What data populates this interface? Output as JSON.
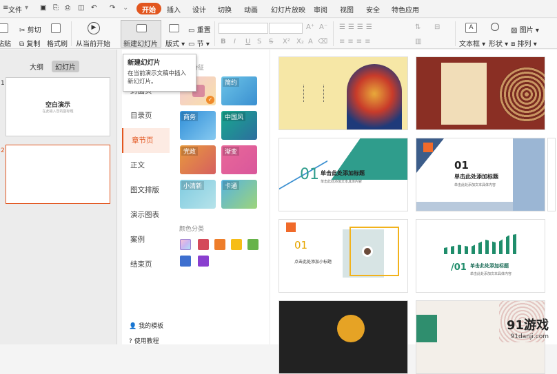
{
  "menubar": {
    "file": "文件",
    "tabs": [
      "开始",
      "插入",
      "设计",
      "切换",
      "动画",
      "幻灯片放映",
      "审阅",
      "视图",
      "安全",
      "特色应用"
    ]
  },
  "ribbon": {
    "cut": "剪切",
    "paste": "粘贴",
    "copy": "复制",
    "format_painter": "格式刷",
    "play_from_current": "从当前开始",
    "new_slide": "新建幻灯片",
    "layout": "版式",
    "reset": "重置",
    "section": "节",
    "textbox": "文本框",
    "shape": "形状",
    "picture": "图片",
    "arrange": "排列"
  },
  "tooltip": {
    "title": "新建幻灯片",
    "desc": "在当前演示文稿中插入新幻灯片。"
  },
  "leftpane": {
    "tab_outline": "大纲",
    "tab_slides": "幻灯片",
    "slide1_num": "1",
    "slide1_title": "空白演示",
    "slide1_subtitle": "在此输入您的副标题",
    "slide2_num": "2"
  },
  "categories": [
    "封面页",
    "目录页",
    "章节页",
    "正文",
    "图文排版",
    "演示图表",
    "案例",
    "结束页"
  ],
  "cat_footer": {
    "my_templates": "我的模板",
    "help": "使用教程"
  },
  "stylepane": {
    "heading": "风格特征",
    "styles": [
      "",
      "简约",
      "商务",
      "中国风",
      "党政",
      "渐变",
      "小清新",
      "卡通"
    ],
    "color_heading": "颜色分类",
    "colors": [
      "#d9c8f0",
      "#d44a5a",
      "#ee7d2a",
      "#f6bd16",
      "#67b34a",
      "#3d6fcf",
      "#8a3fcf"
    ]
  },
  "templates": {
    "t3_num": "01",
    "t3_title": "单击此处添加标题",
    "t3_sub": "单击此处添加文本具体内容",
    "t4_num": "01",
    "t4_title": "单击此处添加标题",
    "t4_sub": "单击此处添加文本具体内容",
    "t5_num": "01",
    "t5_title": "点击此处添加小标题",
    "t6_num": "/01",
    "t6_title": "单击此处添加标题",
    "t6_sub": "单击此处添加文本具体内容"
  },
  "watermark": {
    "logo": "91游戏",
    "url": "91danji.com"
  }
}
